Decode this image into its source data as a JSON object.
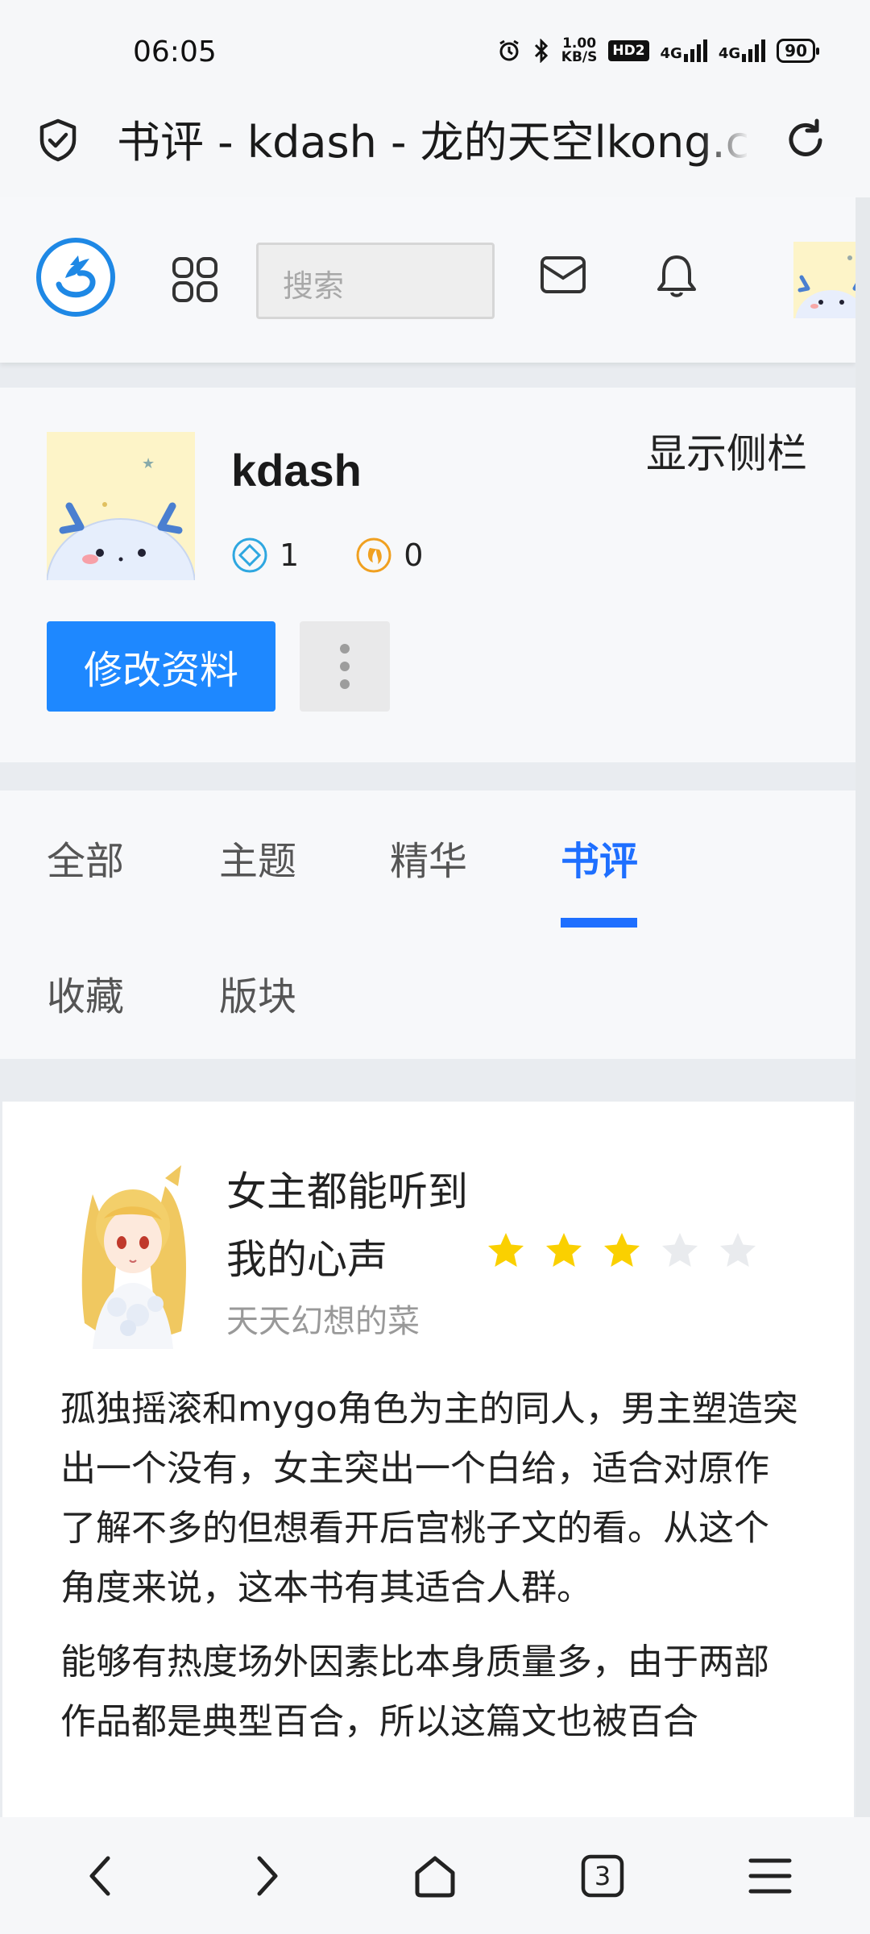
{
  "status": {
    "time": "06:05",
    "speed_value": "1.00",
    "speed_unit": "KB/S",
    "hd_label": "HD2",
    "net1": "4G",
    "net2": "4G",
    "battery": "90"
  },
  "browser": {
    "url_title": "书评 - kdash - 龙的天空lkong.com",
    "tab_count": "3"
  },
  "header": {
    "search_placeholder": "搜索"
  },
  "profile": {
    "username": "kdash",
    "sidebar_toggle": "显示侧栏",
    "stat1_value": "1",
    "stat2_value": "0",
    "edit_label": "修改资料"
  },
  "tabs": [
    {
      "label": "全部"
    },
    {
      "label": "主题"
    },
    {
      "label": "精华"
    },
    {
      "label": "书评"
    },
    {
      "label": "收藏"
    },
    {
      "label": "版块"
    }
  ],
  "review": {
    "title": "女主都能听到我的心声",
    "author": "天天幻想的菜",
    "rating": 3,
    "rating_max": 5,
    "paragraph1": "孤独摇滚和mygo角色为主的同人，男主塑造突出一个没有，女主突出一个白给，适合对原作了解不多的但想看开后宫桃子文的看。从这个角度来说，这本书有其适合人群。",
    "paragraph2": "能够有热度场外因素比本身质量多，由于两部作品都是典型百合，所以这篇文也被百合"
  },
  "colors": {
    "accent": "#1e88ff",
    "active_tab": "#1e6fff",
    "star_on": "#fad000",
    "star_off": "#e9ebee"
  }
}
